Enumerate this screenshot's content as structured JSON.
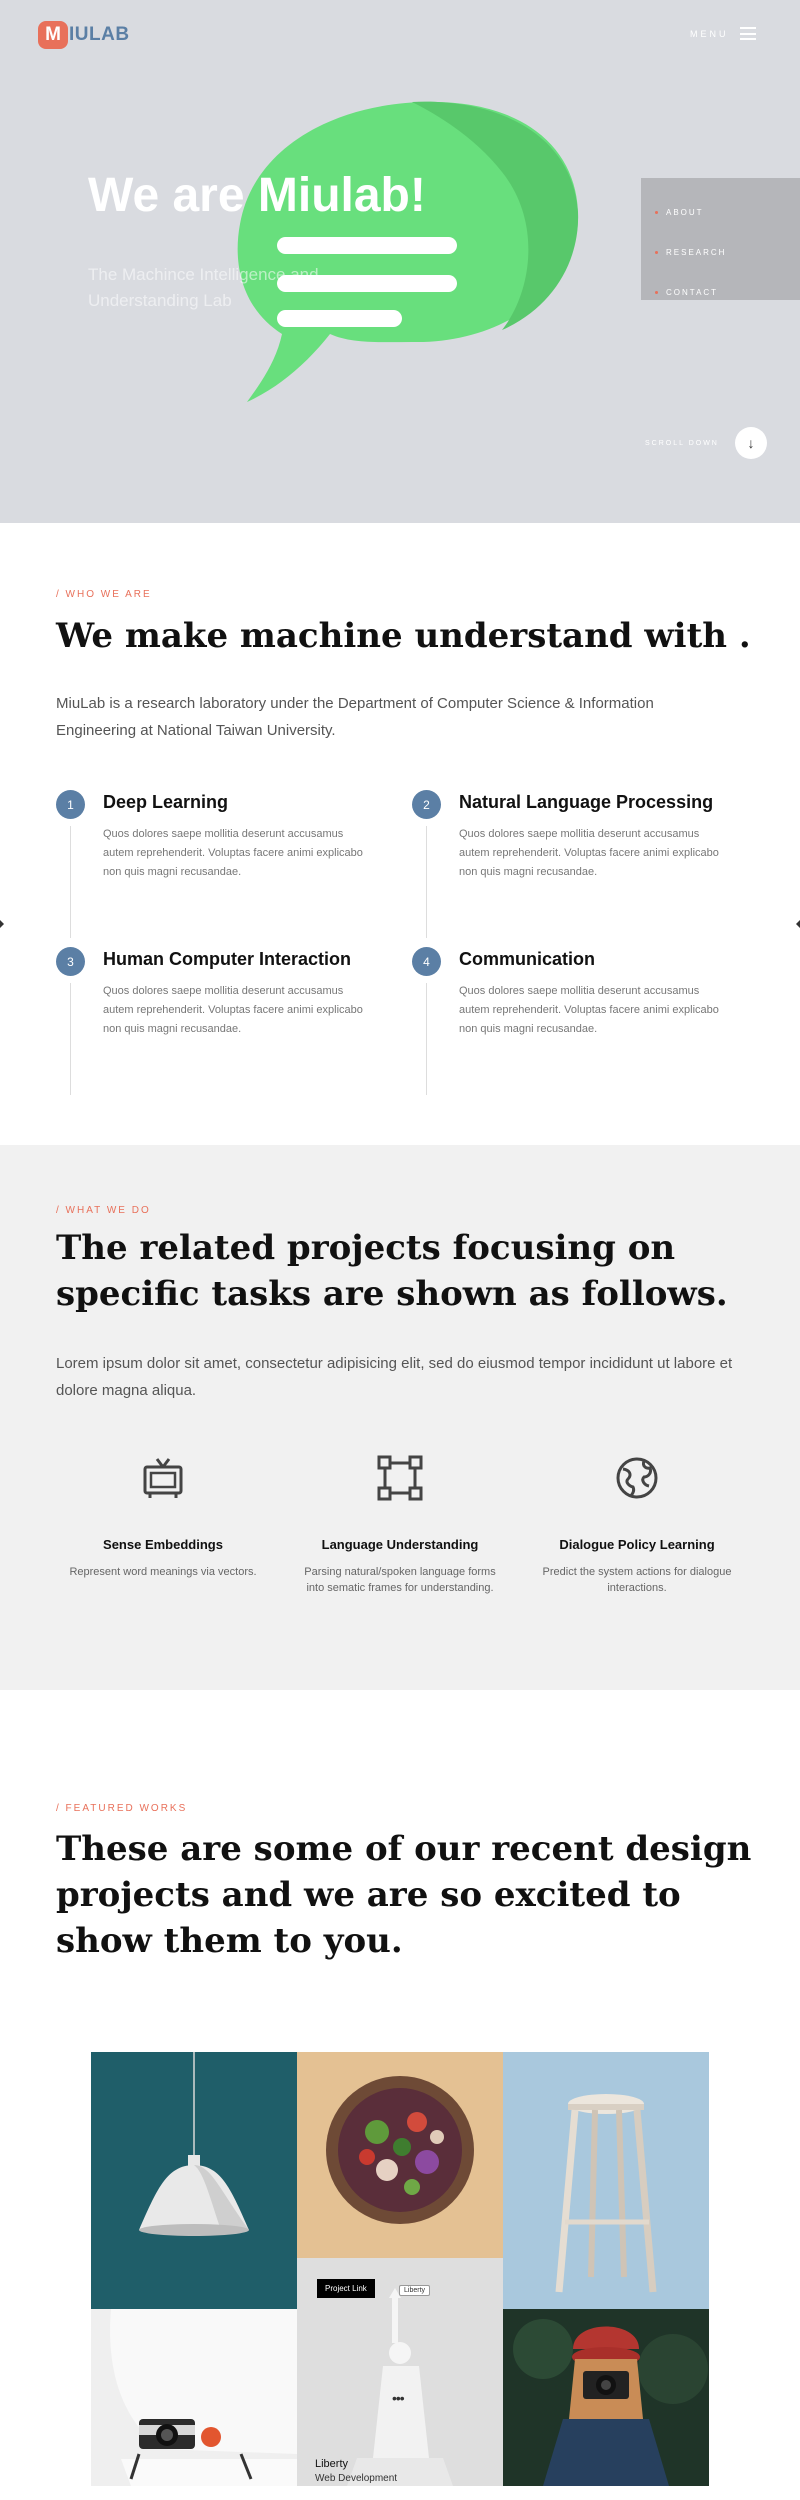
{
  "header": {
    "logo_letter": "M",
    "logo_text": "IULAB",
    "menu_label": "MENU"
  },
  "hero": {
    "title": "We are Miulab!",
    "subtitle": "The Machince Intelligence and Understanding Lab",
    "side_nav": [
      "ABOUT",
      "RESEARCH",
      "CONTACT"
    ],
    "scroll_label": "SCROLL DOWN",
    "scroll_arrow": "↓"
  },
  "who": {
    "eyebrow": "/ WHO WE ARE",
    "title": "We make machine understand with .",
    "lead": "MiuLab is a research laboratory under the Department of Computer Science & Information Engineering at National Taiwan University.",
    "features": [
      {
        "num": "1",
        "title": "Deep Learning",
        "desc": "Quos dolores saepe mollitia deserunt accusamus autem reprehenderit. Voluptas facere animi explicabo non quis magni recusandae."
      },
      {
        "num": "2",
        "title": "Natural Language Processing",
        "desc": "Quos dolores saepe mollitia deserunt accusamus autem reprehenderit. Voluptas facere animi explicabo non quis magni recusandae."
      },
      {
        "num": "3",
        "title": "Human Computer Interaction",
        "desc": "Quos dolores saepe mollitia deserunt accusamus autem reprehenderit. Voluptas facere animi explicabo non quis magni recusandae."
      },
      {
        "num": "4",
        "title": "Communication",
        "desc": "Quos dolores saepe mollitia deserunt accusamus autem reprehenderit. Voluptas facere animi explicabo non quis magni recusandae."
      }
    ]
  },
  "what": {
    "eyebrow": "/ WHAT WE DO",
    "title": "The related projects focusing on specific tasks are shown as follows.",
    "lead": "Lorem ipsum dolor sit amet, consectetur adipisicing elit, sed do eiusmod tempor incididunt ut labore et dolore magna aliqua.",
    "services": [
      {
        "icon": "tv-icon",
        "title": "Sense Embeddings",
        "desc": "Represent word meanings via vectors."
      },
      {
        "icon": "frame-icon",
        "title": "Language Understanding",
        "desc": "Parsing natural/spoken language forms into sematic frames for understanding."
      },
      {
        "icon": "globe-icon",
        "title": "Dialogue Policy Learning",
        "desc": "Predict the system actions for dialogue interactions."
      }
    ]
  },
  "featured": {
    "eyebrow": "/ FEATURED WORKS",
    "title": "These are some of our recent design projects and we are so excited to show them to you.",
    "hover_card": {
      "link_label": "Project Link",
      "tag": "Liberty",
      "more": "•••",
      "name": "Liberty",
      "category": "Web Development"
    }
  },
  "colors": {
    "accent": "#e8705a",
    "brand_blue": "#5b7fa5",
    "hero_bg": "#d9dbe0",
    "bubble_green": "#68df7d"
  }
}
